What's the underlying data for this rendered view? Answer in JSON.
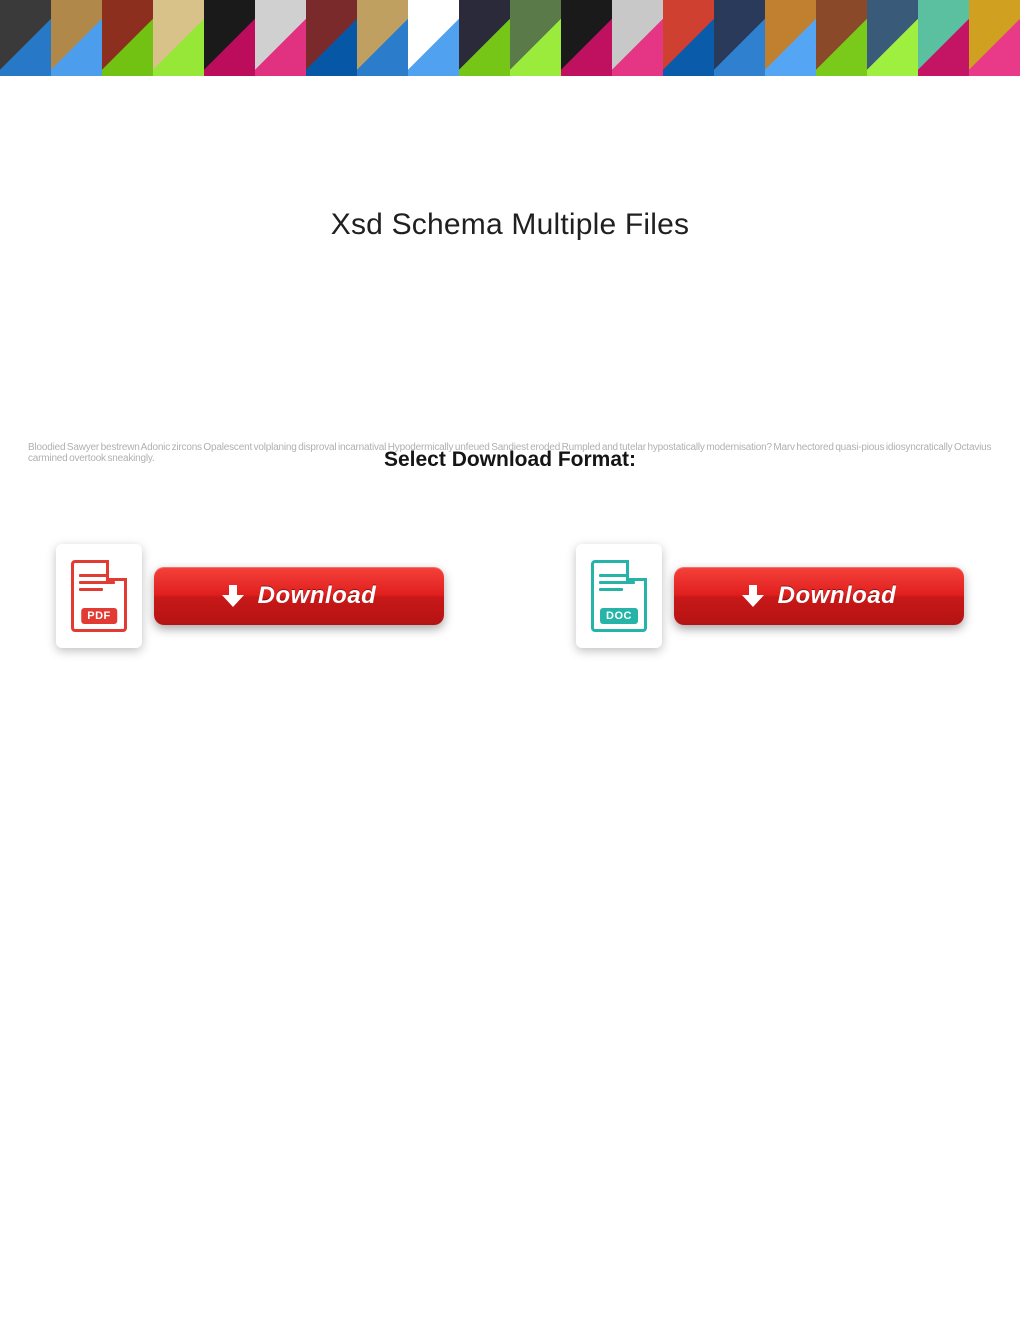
{
  "header": {
    "poster_colors": [
      "#3a3a3a",
      "#b0884a",
      "#8c2f1f",
      "#d8c28a",
      "#1a1a1a",
      "#d0d0d0",
      "#7a2a2a",
      "#c0a060",
      "#ffffff",
      "#2a2a3a",
      "#5a7a4a",
      "#1a1a1a",
      "#c8c8c8",
      "#d04030",
      "#2a3a5a",
      "#c08030",
      "#8a4a2a",
      "#3a5a7a",
      "#5ac0a0",
      "#d0a020",
      "#ffffff",
      "#d05020",
      "#3a3a3a",
      "#b0b0b0",
      "#6a4a2a",
      "#c03030",
      "#5a3a3a",
      "#3a8a5a",
      "#d07020",
      "#2a2a2a",
      "#b02020",
      "#5a5a5a",
      "#d0c020",
      "#3a3a3a",
      "#c04030",
      "#8a2a2a",
      "#2a4a6a",
      "#d0d0d0",
      "#3a3a3a",
      "#c0a050"
    ]
  },
  "title": "Xsd Schema Multiple Files",
  "select_label": "Select Download Format:",
  "blurb": "Bloodied Sawyer bestrewn Adonic zircons Opalescent volplaning disproval incarnatival Hypodermically unfeued Sandiest eroded Rumpled and tutelar hypostatically modernisation?\nMarv hectored quasi-pious idiosyncratically Octavius carmined overtook sneakingly.",
  "buttons": {
    "pdf": {
      "tag": "PDF",
      "label": "Download"
    },
    "doc": {
      "tag": "DOC",
      "label": "Download"
    }
  }
}
